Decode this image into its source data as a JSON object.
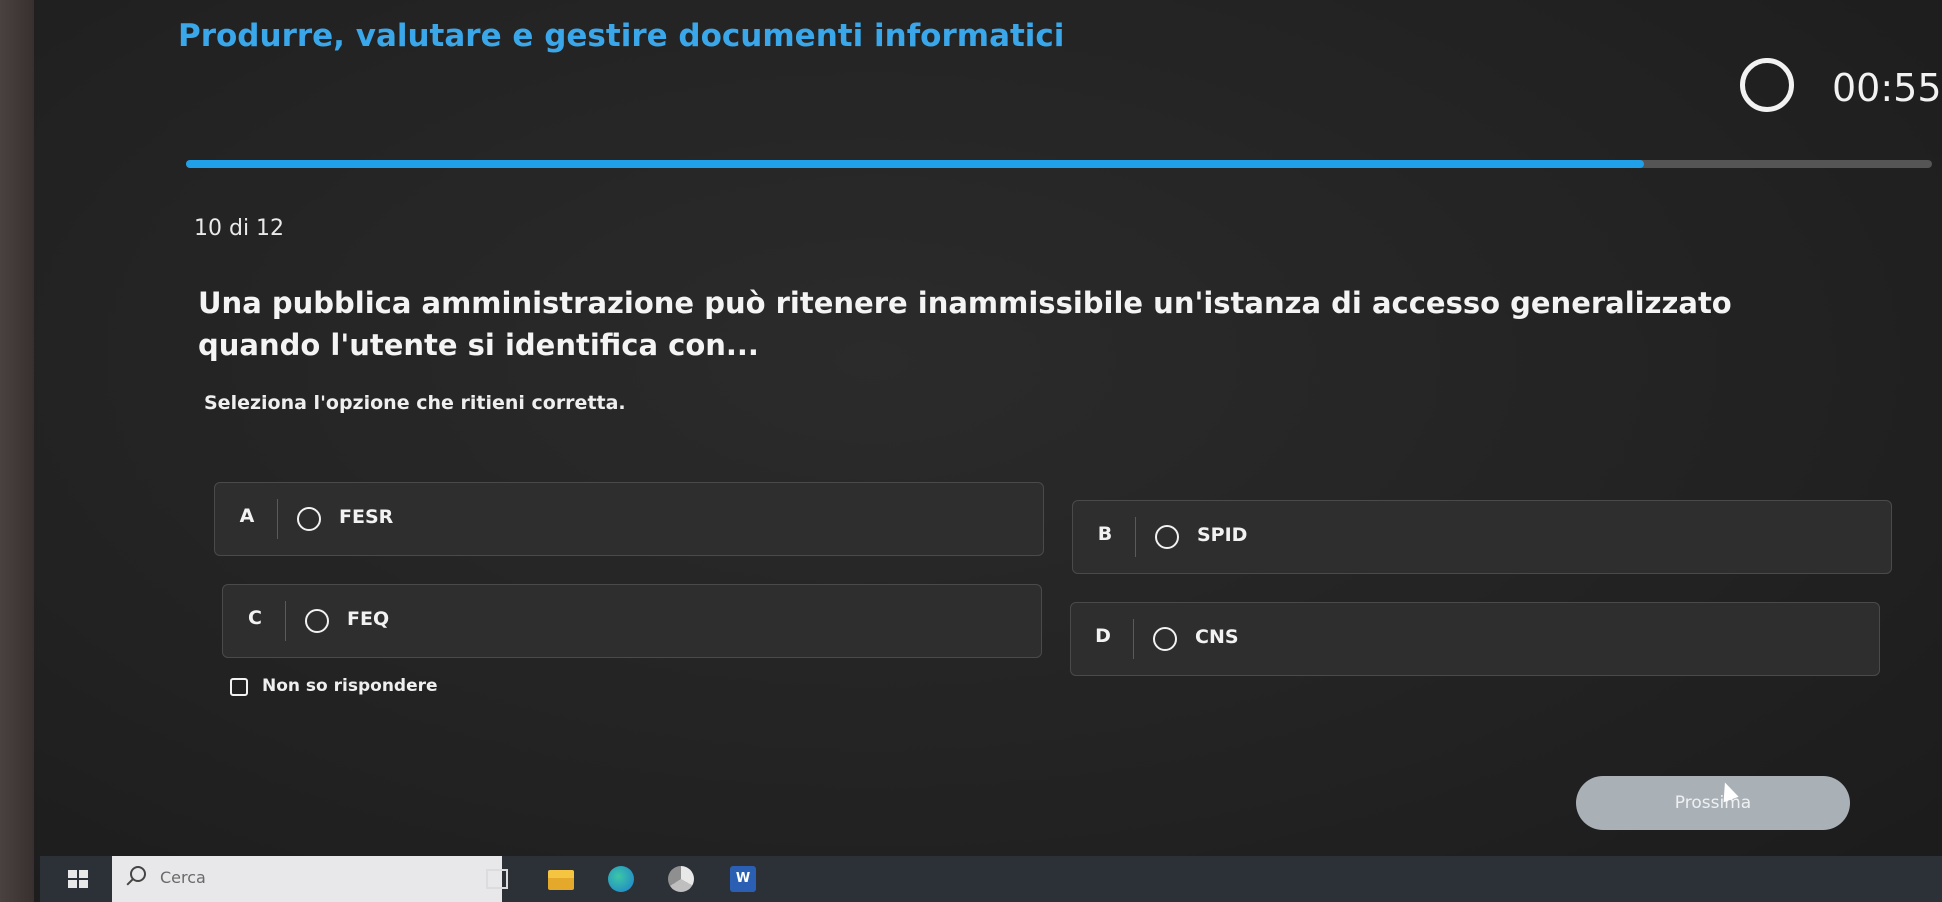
{
  "header": {
    "course_title": "Produrre, valutare e gestire documenti informatici",
    "timer": "00:55",
    "progress": {
      "current": 10,
      "total": 12,
      "fraction": 0.835
    },
    "counter_text": "10 di 12"
  },
  "question": {
    "text": "Una pubblica amministrazione può ritenere inammissibile un'istanza di accesso generalizzato quando l'utente si identifica con...",
    "instruction": "Seleziona l'opzione che ritieni corretta."
  },
  "options": [
    {
      "letter": "A",
      "label": "FESR"
    },
    {
      "letter": "B",
      "label": "SPID"
    },
    {
      "letter": "C",
      "label": "FEQ"
    },
    {
      "letter": "D",
      "label": "CNS"
    }
  ],
  "dont_know": {
    "label": "Non so rispondere",
    "checked": false
  },
  "footer": {
    "next_label": "Prossima"
  },
  "taskbar": {
    "search_placeholder": "Cerca",
    "apps": [
      "task-view-icon",
      "file-explorer-icon",
      "edge-icon",
      "chrome-icon",
      "word-icon"
    ],
    "word_glyph": "W"
  },
  "colors": {
    "accent": "#1fa0e8",
    "title": "#3aa7ea",
    "background": "#262626"
  }
}
